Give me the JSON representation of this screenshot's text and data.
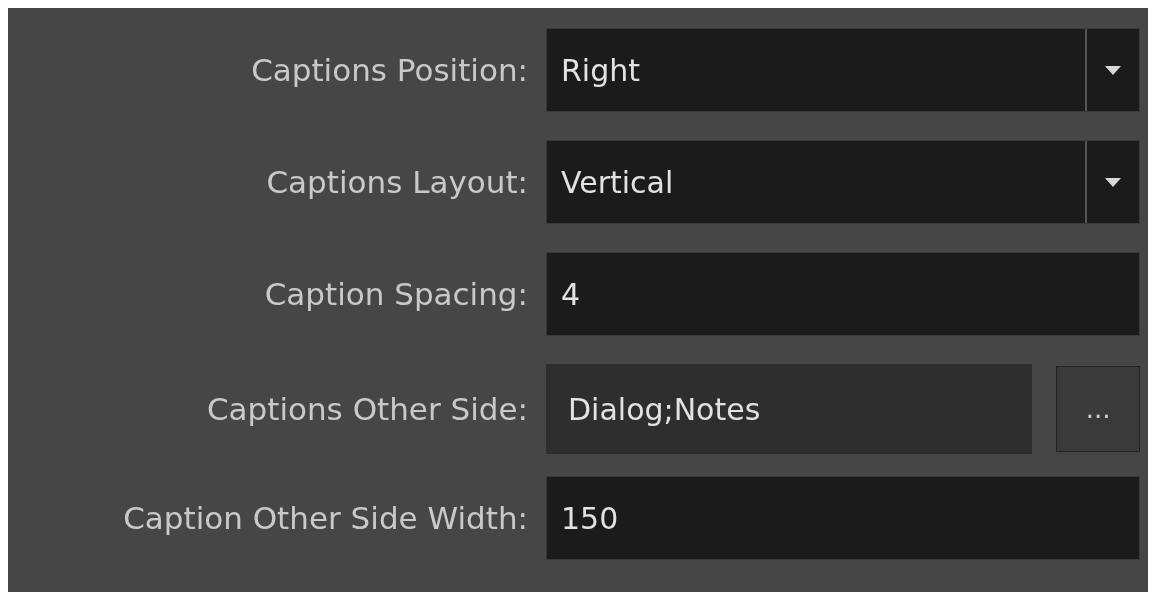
{
  "rows": [
    {
      "kind": "dropdown",
      "label": "Captions Position:",
      "value": "Right"
    },
    {
      "kind": "dropdown",
      "label": "Captions Layout:",
      "value": "Vertical"
    },
    {
      "kind": "text",
      "label": "Caption Spacing:",
      "value": "4"
    },
    {
      "kind": "browse",
      "label": "Captions Other Side:",
      "value": "Dialog;Notes",
      "button": "..."
    },
    {
      "kind": "text",
      "label": "Caption Other Side Width:",
      "value": "150"
    }
  ]
}
